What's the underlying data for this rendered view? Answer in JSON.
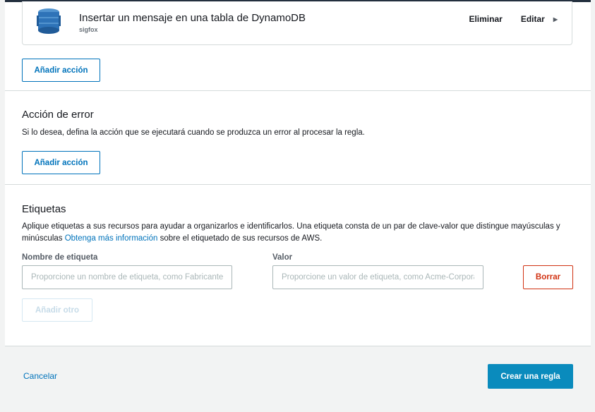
{
  "action": {
    "title": "Insertar un mensaje en una tabla de DynamoDB",
    "subtitle": "sigfox",
    "icon": "dynamodb-icon",
    "delete_label": "Eliminar",
    "edit_label": "Editar"
  },
  "add_action_label": "Añadir acción",
  "error_action": {
    "title": "Acción de error",
    "description": "Si lo desea, defina la acción que se ejecutará cuando se produzca un error al procesar la regla.",
    "add_action_label": "Añadir acción"
  },
  "tags": {
    "title": "Etiquetas",
    "description_before": "Aplique etiquetas a sus recursos para ayudar a organizarlos e identificarlos. Una etiqueta consta de un par de clave-valor que distingue mayúsculas y minúsculas ",
    "learn_more": "Obtenga más información",
    "description_after": " sobre el etiquetado de sus recursos de AWS.",
    "name_label": "Nombre de etiqueta",
    "value_label": "Valor",
    "name_placeholder": "Proporcione un nombre de etiqueta, como Fabricante",
    "value_placeholder": "Proporcione un valor de etiqueta, como Acme-Corporation",
    "remove_label": "Borrar",
    "add_another_label": "Añadir otro"
  },
  "footer": {
    "cancel_label": "Cancelar",
    "create_label": "Crear una regla"
  },
  "colors": {
    "link": "#0073bb",
    "primary": "#0a8bbd",
    "danger": "#d13212",
    "dynamodb": "#2e73b8"
  }
}
